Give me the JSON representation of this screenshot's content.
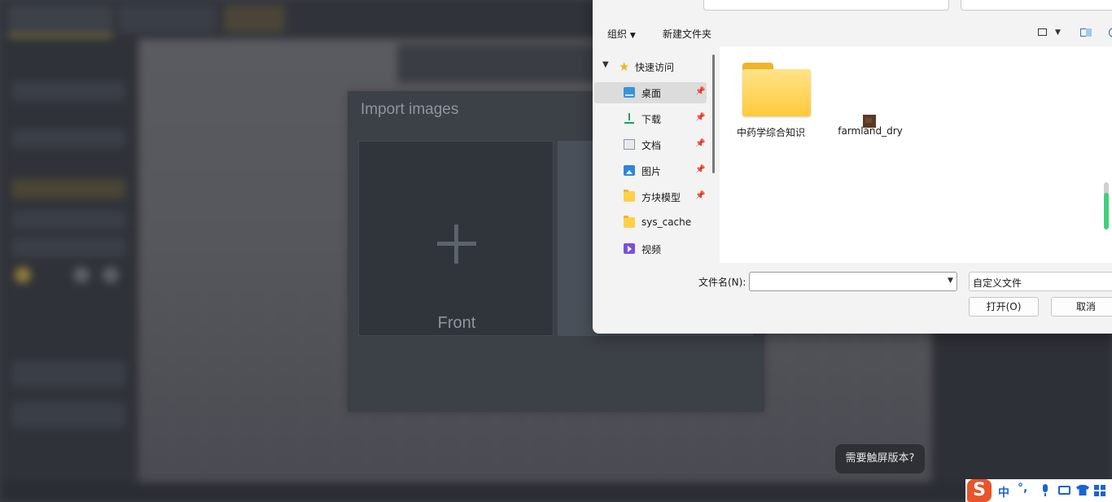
{
  "import_dialog": {
    "title": "Import images",
    "slots": [
      {
        "label": "Front"
      }
    ]
  },
  "file_dialog": {
    "toolbar": {
      "organize": "组织",
      "new_folder": "新建文件夹"
    },
    "nav": {
      "quick_access": "快速访问",
      "items": [
        {
          "label": "桌面",
          "icon": "desktop-icon",
          "pinned": true,
          "selected": true
        },
        {
          "label": "下载",
          "icon": "download-icon",
          "pinned": true
        },
        {
          "label": "文档",
          "icon": "documents-icon",
          "pinned": true
        },
        {
          "label": "图片",
          "icon": "pictures-icon",
          "pinned": true
        },
        {
          "label": "方块模型",
          "icon": "folder-icon",
          "pinned": true
        },
        {
          "label": "sys_cache",
          "icon": "folder-icon",
          "pinned": false
        },
        {
          "label": "视频",
          "icon": "video-icon",
          "pinned": false
        }
      ]
    },
    "files": [
      {
        "name": "中药学综合知识",
        "kind": "folder"
      },
      {
        "name": "farmland_dry",
        "kind": "image"
      }
    ],
    "filename_label": "文件名(N):",
    "filename_value": "",
    "filetype_value": "自定义文件",
    "open_button": "打开(O)",
    "cancel_button": "取消"
  },
  "toast": {
    "text": "需要触屏版本?"
  },
  "tray": {
    "ime_logo": "S",
    "ime_mode": "中",
    "punct": "°,"
  }
}
